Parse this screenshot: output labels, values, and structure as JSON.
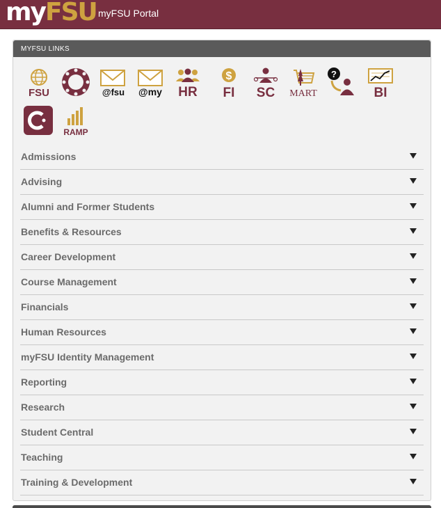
{
  "header": {
    "logo_my": "my",
    "logo_fsu": "FSU",
    "portal_title": "myFSU Portal"
  },
  "panel": {
    "title": "MYFSU LINKS"
  },
  "icons": {
    "fsu": "FSU",
    "canvas_label": "",
    "mail_fsu": "@fsu",
    "mail_my": "@my",
    "hr": "HR",
    "fi": "FI",
    "sc": "SC",
    "mart": "MART",
    "bi": "BI",
    "ramp": "RAMP"
  },
  "menu": [
    {
      "label": "Admissions"
    },
    {
      "label": "Advising"
    },
    {
      "label": "Alumni and Former Students"
    },
    {
      "label": "Benefits & Resources"
    },
    {
      "label": "Career Development"
    },
    {
      "label": "Course Management"
    },
    {
      "label": "Financials"
    },
    {
      "label": "Human Resources"
    },
    {
      "label": "myFSU Identity Management"
    },
    {
      "label": "Reporting"
    },
    {
      "label": "Research"
    },
    {
      "label": "Student Central"
    },
    {
      "label": "Teaching"
    },
    {
      "label": "Training & Development"
    }
  ],
  "colors": {
    "garnet": "#782f40",
    "gold": "#cea240",
    "panel_header": "#5a5a5a"
  }
}
